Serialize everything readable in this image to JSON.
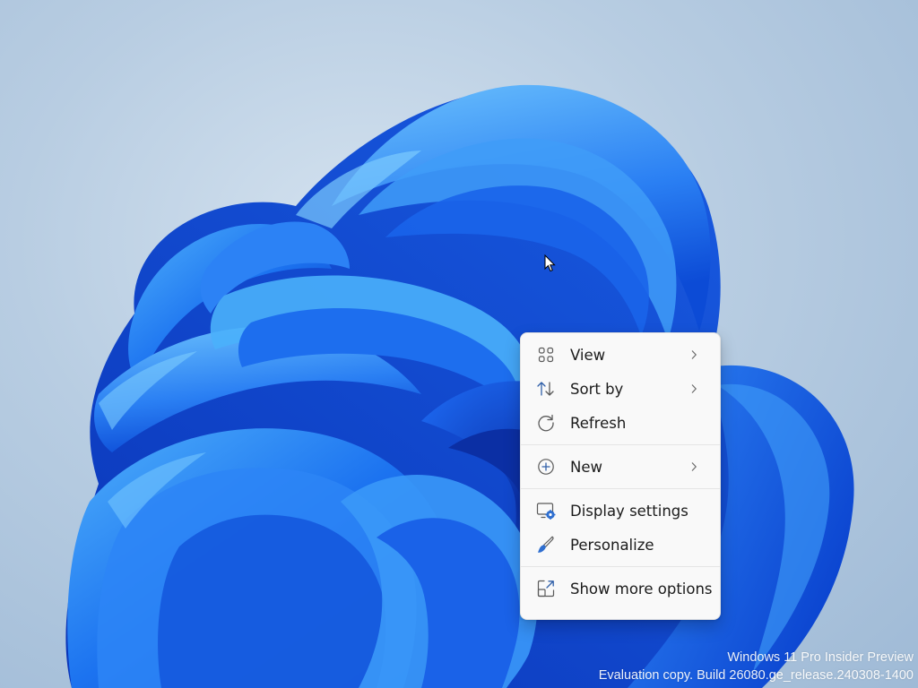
{
  "desktop": {
    "wallpaper": {
      "name": "windows-11-bloom",
      "background_color": "#b8cde2",
      "bloom_colors": [
        "#0a3fd1",
        "#1a6ef0",
        "#2f8cf8",
        "#57b2fb"
      ]
    }
  },
  "cursor": {
    "icon": "arrow-pointer-icon"
  },
  "context_menu": {
    "items": [
      {
        "label": "View",
        "icon": "grid-view-icon",
        "has_submenu": true
      },
      {
        "label": "Sort by",
        "icon": "sort-arrows-icon",
        "has_submenu": true
      },
      {
        "label": "Refresh",
        "icon": "refresh-icon",
        "has_submenu": false
      },
      {
        "label": "New",
        "icon": "plus-circle-icon",
        "has_submenu": true
      },
      {
        "label": "Display settings",
        "icon": "display-settings-icon",
        "has_submenu": false
      },
      {
        "label": "Personalize",
        "icon": "brush-icon",
        "has_submenu": false
      },
      {
        "label": "Show more options",
        "icon": "show-more-options-icon",
        "has_submenu": false
      }
    ]
  },
  "watermark": {
    "line1": "Windows 11 Pro Insider Preview",
    "line2": "Evaluation copy. Build 26080.ge_release.240308-1400"
  }
}
